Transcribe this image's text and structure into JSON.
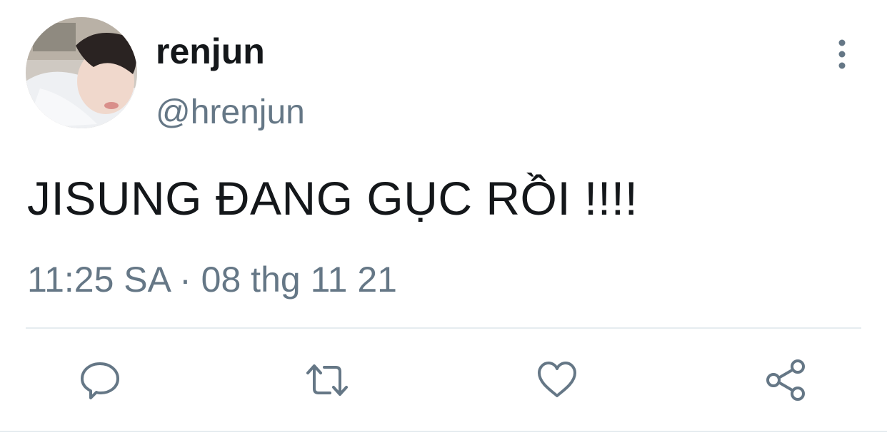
{
  "user": {
    "display_name": "renjun",
    "handle": "@hrenjun"
  },
  "tweet": {
    "text": "JISUNG ĐANG GỤC RỒI !!!!",
    "timestamp": "11:25 SA · 08 thg 11 21"
  },
  "icons": {
    "more": "more-vertical-icon",
    "reply": "reply-icon",
    "retweet": "retweet-icon",
    "like": "heart-icon",
    "share": "share-icon"
  },
  "colors": {
    "text_primary": "#14171a",
    "text_secondary": "#657786",
    "icon": "#657786",
    "divider": "#e6ecf0"
  }
}
